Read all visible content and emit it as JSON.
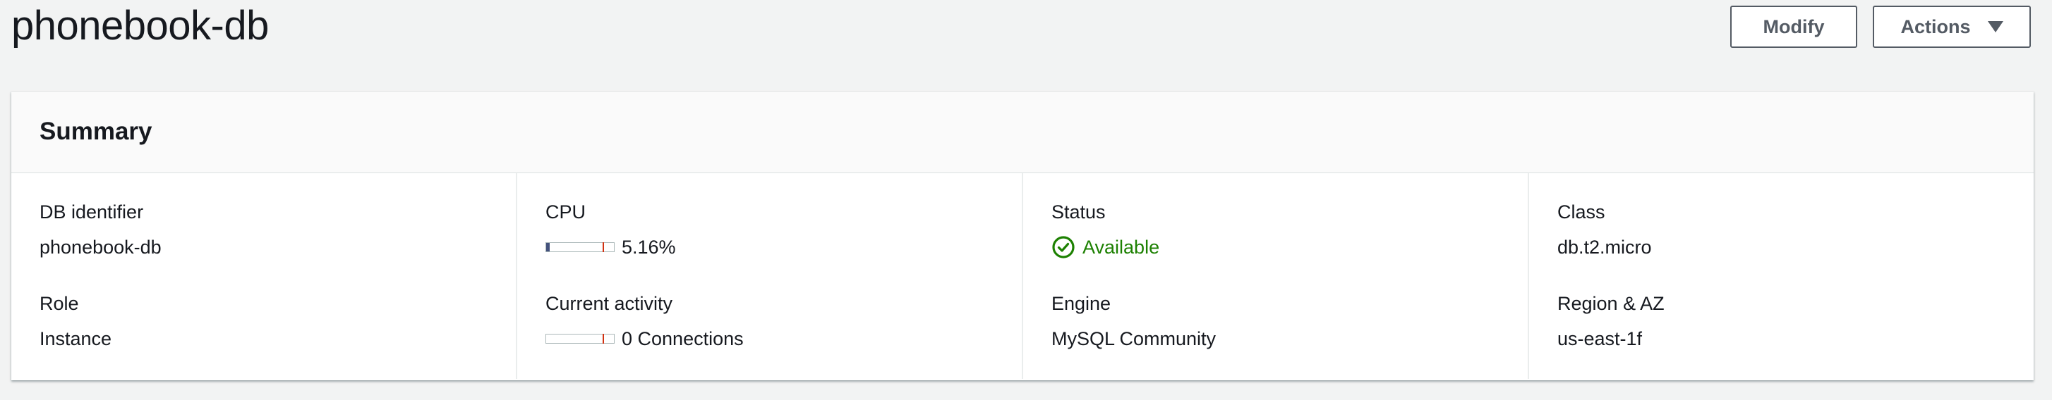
{
  "page": {
    "title": "phonebook-db",
    "modify_label": "Modify",
    "actions_label": "Actions"
  },
  "summary": {
    "title": "Summary",
    "db_identifier": {
      "label": "DB identifier",
      "value": "phonebook-db"
    },
    "role": {
      "label": "Role",
      "value": "Instance"
    },
    "cpu": {
      "label": "CPU",
      "value": "5.16%",
      "fraction": 0.0516
    },
    "activity": {
      "label": "Current activity",
      "value": "0 Connections",
      "fraction": 0
    },
    "status": {
      "label": "Status",
      "value": "Available",
      "color": "#1d8102"
    },
    "engine": {
      "label": "Engine",
      "value": "MySQL Community"
    },
    "class": {
      "label": "Class",
      "value": "db.t2.micro"
    },
    "region": {
      "label": "Region & AZ",
      "value": "us-east-1f"
    }
  }
}
